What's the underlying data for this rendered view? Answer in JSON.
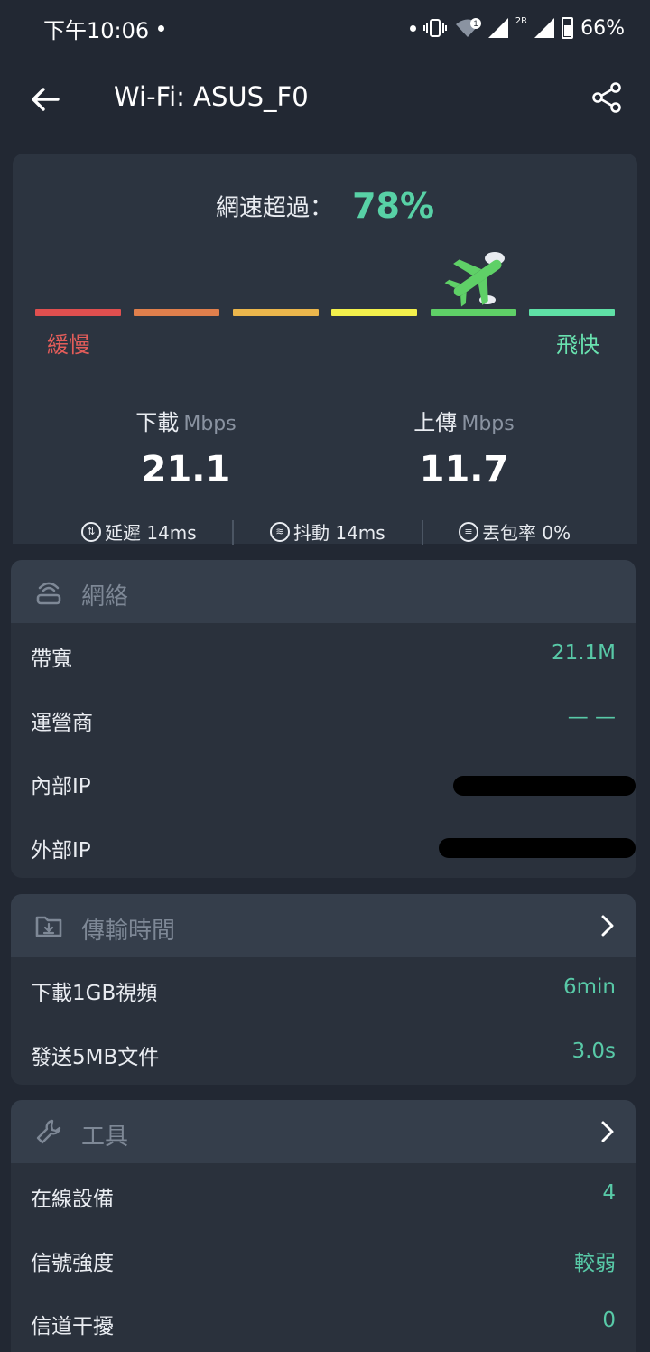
{
  "status_bar": {
    "time": "下午10:06",
    "battery": "66%",
    "notif_badge": "1",
    "sim2_label": "2R"
  },
  "toolbar": {
    "title": "Wi-Fi: ASUS_F0"
  },
  "speed": {
    "beat_label": "網速超過：",
    "beat_percent": "78%",
    "slow_label": "緩慢",
    "fast_label": "飛快",
    "gauge_colors": [
      "#e04f4f",
      "#e07f4c",
      "#ebb64c",
      "#f3f04c",
      "#5fd067",
      "#5fe0a6"
    ],
    "download": {
      "label": "下載",
      "unit": "Mbps",
      "value": "21.1"
    },
    "upload": {
      "label": "上傳",
      "unit": "Mbps",
      "value": "11.7"
    },
    "latency": "延遲 14ms",
    "jitter": "抖動 14ms",
    "loss": "丟包率 0%"
  },
  "network": {
    "title": "網絡",
    "rows": [
      {
        "label": "帶寬",
        "value": "21.1M"
      },
      {
        "label": "運營商",
        "value": "— —"
      },
      {
        "label": "內部IP",
        "value": ""
      },
      {
        "label": "外部IP",
        "value": ""
      }
    ]
  },
  "transfer": {
    "title": "傳輸時間",
    "rows": [
      {
        "label": "下載1GB視頻",
        "value": "6min"
      },
      {
        "label": "發送5MB文件",
        "value": "3.0s"
      }
    ]
  },
  "tools": {
    "title": "工具",
    "rows": [
      {
        "label": "在線設備",
        "value": "4"
      },
      {
        "label": "信號強度",
        "value": "較弱"
      },
      {
        "label": "信道干擾",
        "value": "0"
      }
    ]
  },
  "colors": {
    "accent": "#58d1a6",
    "background": "#222833",
    "card": "#2c3440"
  }
}
